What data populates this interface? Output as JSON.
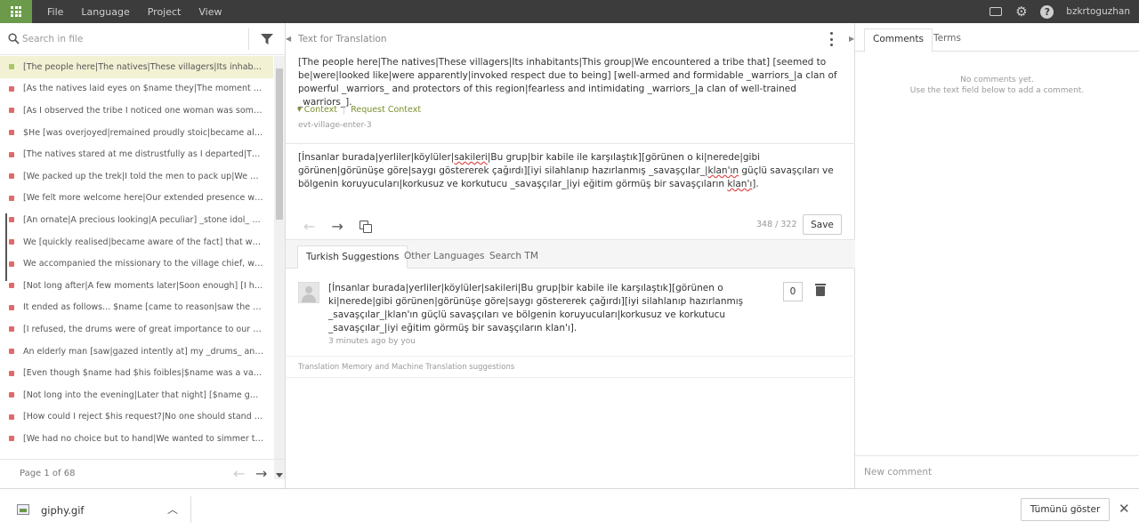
{
  "menu": {
    "items": [
      "File",
      "Language",
      "Project",
      "View"
    ]
  },
  "user": {
    "name": "bzkrtoguzhan"
  },
  "search": {
    "placeholder": "Search in file"
  },
  "strings": [
    {
      "text": "[The people here|The natives|These villagers|Its inhabitants...",
      "status": "green",
      "active": true
    },
    {
      "text": "[As the natives laid eyes on $name they|The moment the nati...",
      "status": "red",
      "active": false
    },
    {
      "text": "[As I observed the tribe I noticed one woman was somewhat ...",
      "status": "red",
      "active": false
    },
    {
      "text": "$He [was overjoyed|remained proudly stoic|became almost ...",
      "status": "red",
      "active": false
    },
    {
      "text": "[The natives stared at me distrustfully as I departed|The nativ...",
      "status": "red",
      "active": false
    },
    {
      "text": "[We packed up the trek|I told the men to pack up|We got rea...",
      "status": "red",
      "active": false
    },
    {
      "text": "[We felt more welcome here|Our extended presence was per...",
      "status": "red",
      "active": false
    },
    {
      "text": "[An ornate|A precious looking|A peculiar] _stone idol_ [stood...",
      "status": "red",
      "active": false
    },
    {
      "text": "We [quickly realised|became aware of the fact] that we [had ...",
      "status": "red",
      "active": false
    },
    {
      "text": "We accompanied the missionary to the village chief, who [was...",
      "status": "red",
      "active": false
    },
    {
      "text": "[Not long after|A few moments later|Soon enough] [I had as...",
      "status": "red",
      "active": false
    },
    {
      "text": "It ended as follows... $name [came to reason|saw the truth in...",
      "status": "red",
      "active": false
    },
    {
      "text": "[I refused, the drums were of great importance to our expedit...",
      "status": "red",
      "active": false
    },
    {
      "text": "An elderly man [saw|gazed intently at] my _drums_ and aske...",
      "status": "red",
      "active": false
    },
    {
      "text": "[Even though $name had $his foibles|$name was a valuable ...",
      "status": "red",
      "active": false
    },
    {
      "text": "[Not long into the evening|Later that night] [$name got into a...",
      "status": "red",
      "active": false
    },
    {
      "text": "[How could I reject $his request?|No one should stand in the ...",
      "status": "red",
      "active": false
    },
    {
      "text": "[We had no choice but to hand|We wanted to simmer the sit...",
      "status": "red",
      "active": false
    }
  ],
  "pager": {
    "label": "Page 1 of 68"
  },
  "editor": {
    "title": "Text for Translation",
    "source": "[The people here|The natives|These villagers|Its inhabitants|This group|We encountered a tribe that] [seemed to be|were|looked like|were apparently|invoked respect due to being] [well-armed and formidable _warriors_|a clan of powerful _warriors_ and protectors of this region|fearless and intimidating _warriors_|a clan of well-trained _warriors_].",
    "context_label": "Context",
    "request_context_label": "Request Context",
    "context_key": "evt-village-enter-3",
    "translation_part1": "[İnsanlar burada|yerliler|köylüler|",
    "translation_underline1": "sakileri",
    "translation_part2": "|Bu grup|bir kabile ile karşılaştık][görünen o ki|nerede|gibi görünen|görünüşe göre|saygı göstererek çağırdı][iyi silahlanıp hazırlanmış _savaşçılar_|",
    "translation_underline2": "klan'ın",
    "translation_part3": " güçlü savaşçıları ve bölgenin koruyucuları|korkusuz ve korkutucu _savaşçılar_|iyi eğitim görmüş bir savaşçıların ",
    "translation_underline3": "klan'ı",
    "translation_part4": "].",
    "char_count": "348 / 322",
    "save_label": "Save"
  },
  "suggestions": {
    "tabs": [
      "Turkish Suggestions",
      "Other Languages",
      "Search TM"
    ],
    "item": {
      "text": "[İnsanlar burada|yerliler|köylüler|sakileri|Bu grup|bir kabile ile karşılaştık][görünen o ki|nerede|gibi görünen|görünüşe göre|saygı göstererek çağırdı][iyi silahlanıp hazırlanmış _savaşçılar_|klan'ın güçlü savaşçıları ve bölgenin koruyucuları|korkusuz ve korkutucu _savaşçılar_|iyi eğitim görmüş bir savaşçıların klan'ı].",
      "meta": "3 minutes ago by you",
      "votes": "0"
    },
    "tm_note": "Translation Memory and Machine Translation suggestions"
  },
  "comments": {
    "tabs": [
      "Comments",
      "Terms"
    ],
    "empty_line1": "No comments yet.",
    "empty_line2": "Use the text field below to add a comment.",
    "new_placeholder": "New comment"
  },
  "download": {
    "file_name": "giphy.gif",
    "show_all_label": "Tümünü göster"
  },
  "colors": {
    "topbar": "#3c3c3c",
    "apps_accent": "#6a9a4a",
    "active_row": "#f3f1d4",
    "status_red": "#e06a6a",
    "status_green": "#a8c868",
    "context_link": "#7a8f2e"
  }
}
